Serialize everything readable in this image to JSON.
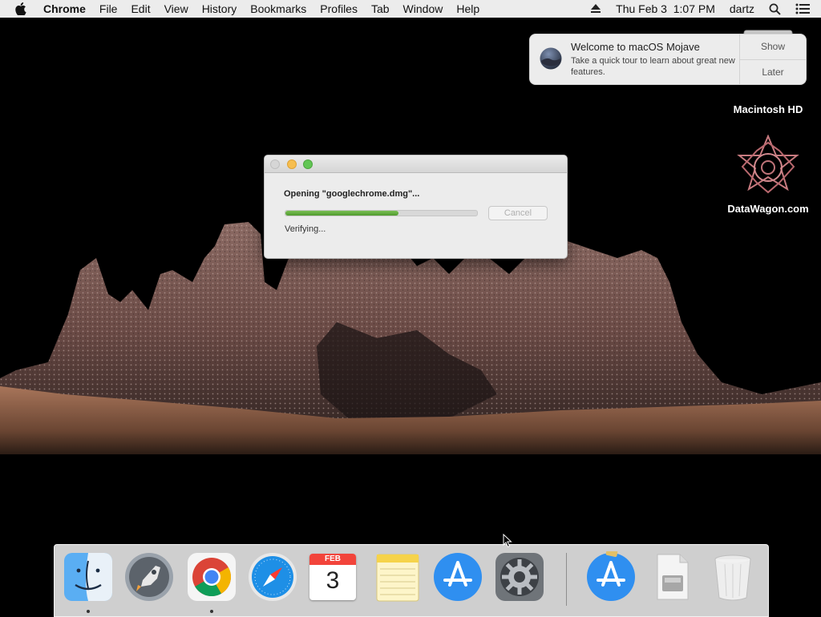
{
  "menubar": {
    "app_name": "Chrome",
    "items": [
      "File",
      "Edit",
      "View",
      "History",
      "Bookmarks",
      "Profiles",
      "Tab",
      "Window",
      "Help"
    ],
    "clock": "Thu Feb 3  1:07 PM",
    "user": "dartz"
  },
  "notification": {
    "title": "Welcome to macOS Mojave",
    "body": "Take a quick tour to learn about great new features.",
    "show_label": "Show",
    "later_label": "Later"
  },
  "desktop_icons": {
    "hd_label": "Macintosh HD",
    "datawagon_label": "DataWagon.com"
  },
  "dialog": {
    "heading": "Opening \"googlechrome.dmg\"...",
    "cancel_label": "Cancel",
    "status": "Verifying...",
    "progress_percent": 59
  },
  "dock": {
    "calendar_month": "FEB",
    "calendar_day": "3"
  },
  "colors": {
    "progress_green": "#5aa834",
    "menubar_bg": "#ececec",
    "notif_bg": "#ececec"
  }
}
